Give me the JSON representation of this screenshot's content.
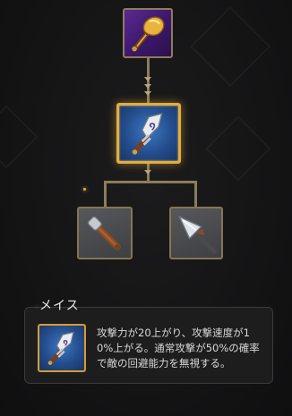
{
  "skill_tree": {
    "nodes": [
      {
        "id": "top",
        "icon": "golden-club-icon",
        "state": "learned"
      },
      {
        "id": "mid",
        "icon": "mace-icon",
        "state": "selected"
      },
      {
        "id": "left",
        "icon": "hammer-icon",
        "state": "available"
      },
      {
        "id": "right",
        "icon": "spear-icon",
        "state": "available"
      }
    ]
  },
  "detail": {
    "title": "メイス",
    "description": "攻撃力が20上がり、攻撃速度が10%上がる。通常攻撃が50%の確率で敵の回避能力を無視する。",
    "icon": "mace-icon"
  },
  "colors": {
    "background": "#141415",
    "selected_border": "#e5ad3b",
    "node_border": "#857552",
    "connector": "#8b7d5b"
  }
}
